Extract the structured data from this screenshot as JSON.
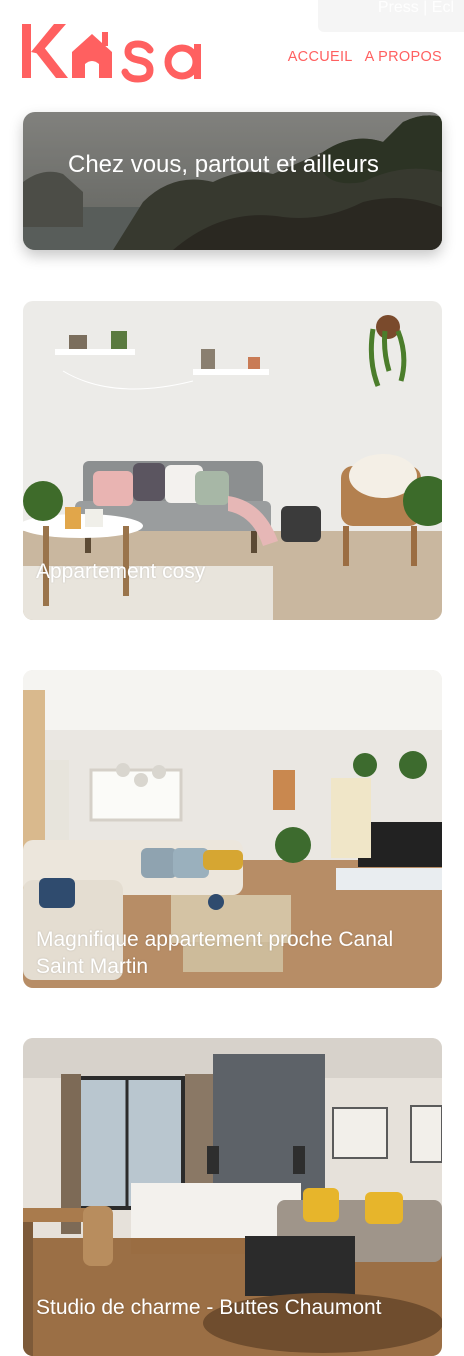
{
  "overlay": {
    "text": "Press | Ecl"
  },
  "header": {
    "logo_text": "Kasa",
    "nav": [
      {
        "label": "ACCUEIL"
      },
      {
        "label": "A PROPOS"
      }
    ]
  },
  "banner": {
    "title": "Chez vous, partout et ailleurs"
  },
  "listings": [
    {
      "title": "Appartement cosy"
    },
    {
      "title": "Magnifique appartement proche Canal Saint Martin"
    },
    {
      "title": "Studio de charme - Buttes Chaumont"
    }
  ],
  "colors": {
    "brand": "#FF6060",
    "text_on_image": "#FFFFFF"
  }
}
